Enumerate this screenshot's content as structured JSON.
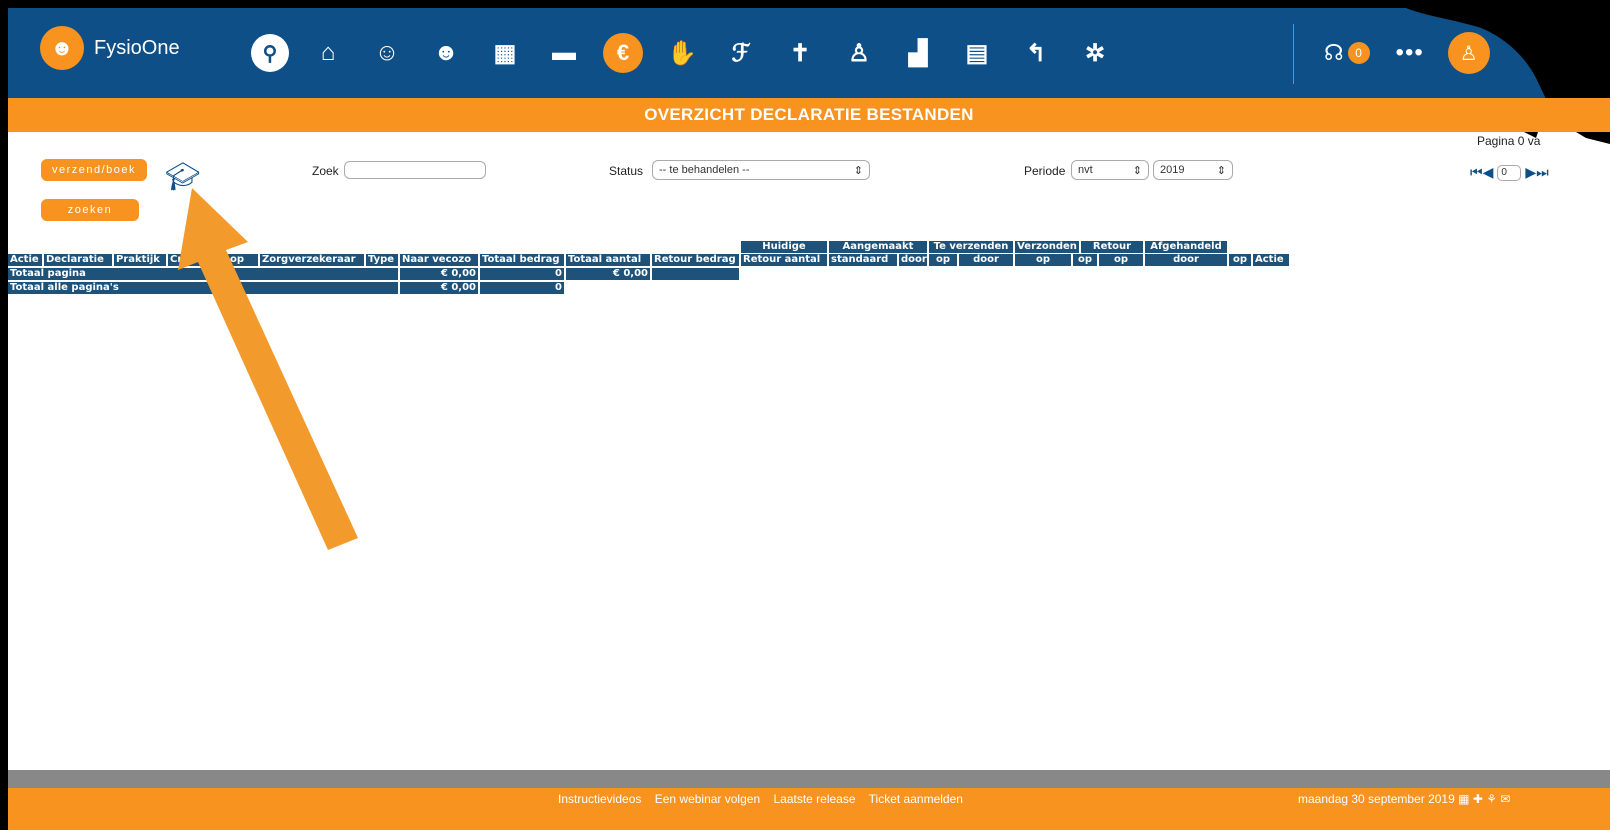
{
  "app": {
    "name": "FysioOne"
  },
  "nav": {
    "icons": [
      "search-icon",
      "home-icon",
      "add-user-icon",
      "users-icon",
      "calendar-icon",
      "folder-icon",
      "euro-icon",
      "handshake-icon",
      "exercise-icon",
      "posture-icon",
      "hierarchy-icon",
      "stats-icon",
      "address-book-icon",
      "reply-icon",
      "settings-icon"
    ],
    "badge_count": "0",
    "more": "•••"
  },
  "page_title": "OVERZICHT DECLARATIE BESTANDEN",
  "controls": {
    "verzend_button": "verzend/boek",
    "zoeken_button": "zoeken",
    "zoek_label": "Zoek",
    "zoek_value": "",
    "status_label": "Status",
    "status_value": "-- te behandelen --",
    "periode_label": "Periode",
    "periode_value": "nvt",
    "year_value": "2019",
    "pagina_label": "Pagina 0 va",
    "page_input": "0"
  },
  "table": {
    "group_headers": [
      "Huidige",
      "Aangemaakt",
      "Te verzenden",
      "Verzonden",
      "Retour",
      "Afgehandeld"
    ],
    "headers": [
      "Actie",
      "Declaratie",
      "Praktijk",
      "Cr",
      "op",
      "Zorgverzekeraar",
      "Type",
      "Naar vecozo",
      "Totaal bedrag",
      "Totaal aantal",
      "Retour bedrag",
      "Retour aantal",
      "standaard",
      "door",
      "op",
      "door",
      "op",
      "op",
      "op",
      "door",
      "op",
      "Actie"
    ],
    "totaal_pagina": {
      "label": "Totaal pagina",
      "naar_vecozo": "€ 0,00",
      "totaal_bedrag": "0",
      "totaal_aantal": "€ 0,00"
    },
    "totaal_alle": {
      "label": "Totaal alle pagina's",
      "naar_vecozo": "€ 0,00",
      "totaal_bedrag": "0"
    }
  },
  "footer": {
    "links": [
      "Instructievideos",
      "Een webinar volgen",
      "Laatste release",
      "Ticket aanmelden"
    ],
    "date": "maandag 30 september 2019"
  },
  "colors": {
    "navy": "#0d4f86",
    "orange": "#f7931e",
    "table_header": "#1f5279"
  }
}
